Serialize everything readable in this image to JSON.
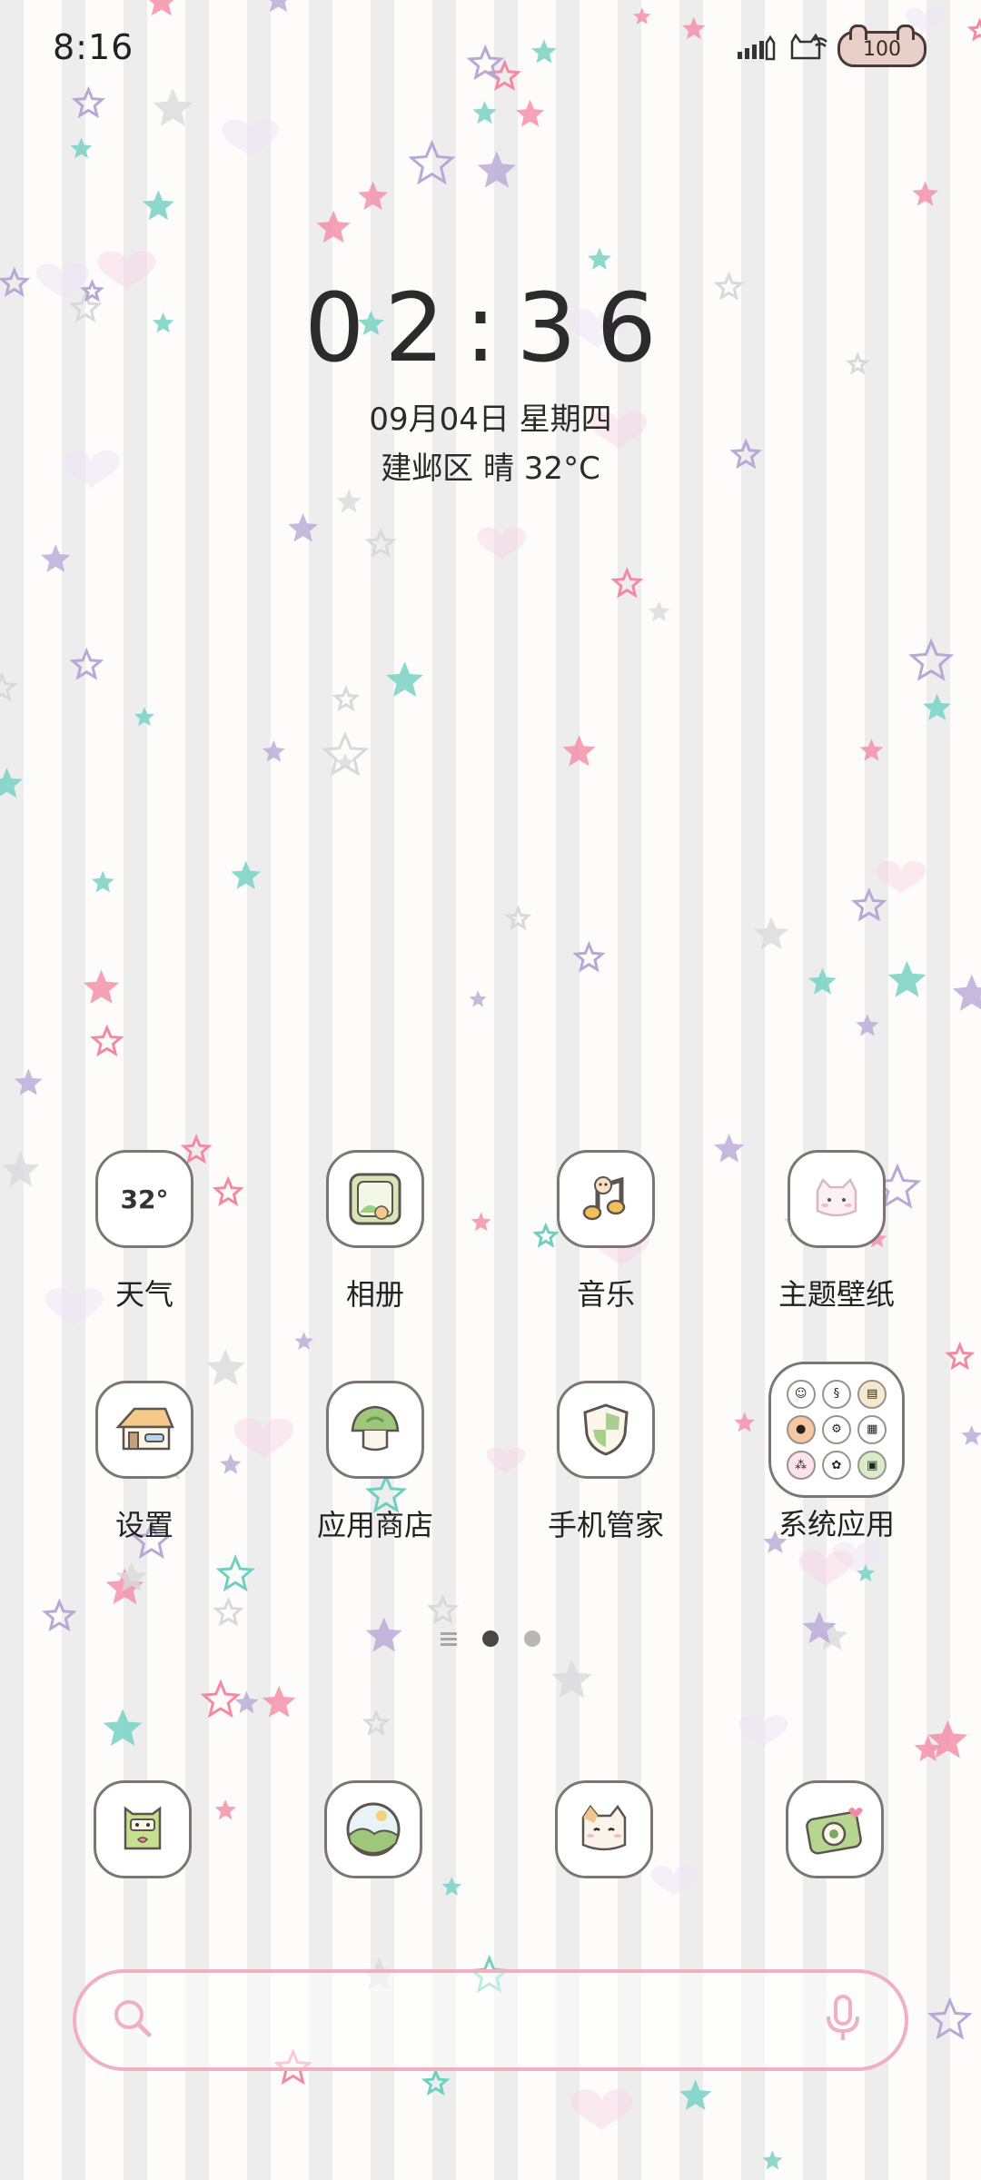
{
  "status_bar": {
    "time": "8:16",
    "battery": "100",
    "icons": [
      "signal-icon",
      "cat-icon",
      "wifi-icon",
      "battery-icon"
    ]
  },
  "clock_widget": {
    "time": "02:36",
    "date": "09月04日 星期四",
    "weather": "建邺区 晴 32°C"
  },
  "apps": [
    {
      "label": "天气",
      "icon": "weather-icon",
      "icon_text": "32°"
    },
    {
      "label": "相册",
      "icon": "gallery-icon"
    },
    {
      "label": "音乐",
      "icon": "music-icon"
    },
    {
      "label": "主题壁纸",
      "icon": "themes-icon"
    },
    {
      "label": "设置",
      "icon": "settings-house-icon"
    },
    {
      "label": "应用商店",
      "icon": "app-store-icon"
    },
    {
      "label": "手机管家",
      "icon": "phone-manager-shield-icon"
    },
    {
      "label": "系统应用",
      "icon": "system-apps-folder-icon"
    }
  ],
  "page_indicator": {
    "pages": 2,
    "current": 1
  },
  "dock": [
    {
      "icon": "phone-frog-icon"
    },
    {
      "icon": "browser-landscape-icon"
    },
    {
      "icon": "messages-cat-icon"
    },
    {
      "icon": "camera-icon"
    }
  ],
  "search_bar": {
    "icons": [
      "search-icon",
      "microphone-icon"
    ]
  },
  "colors": {
    "accent_pink": "#efb1c2",
    "icon_border": "#7c7573",
    "star_pink": "#f28aa5",
    "star_teal": "#6fd0c0",
    "star_purple": "#b8a8d6"
  }
}
